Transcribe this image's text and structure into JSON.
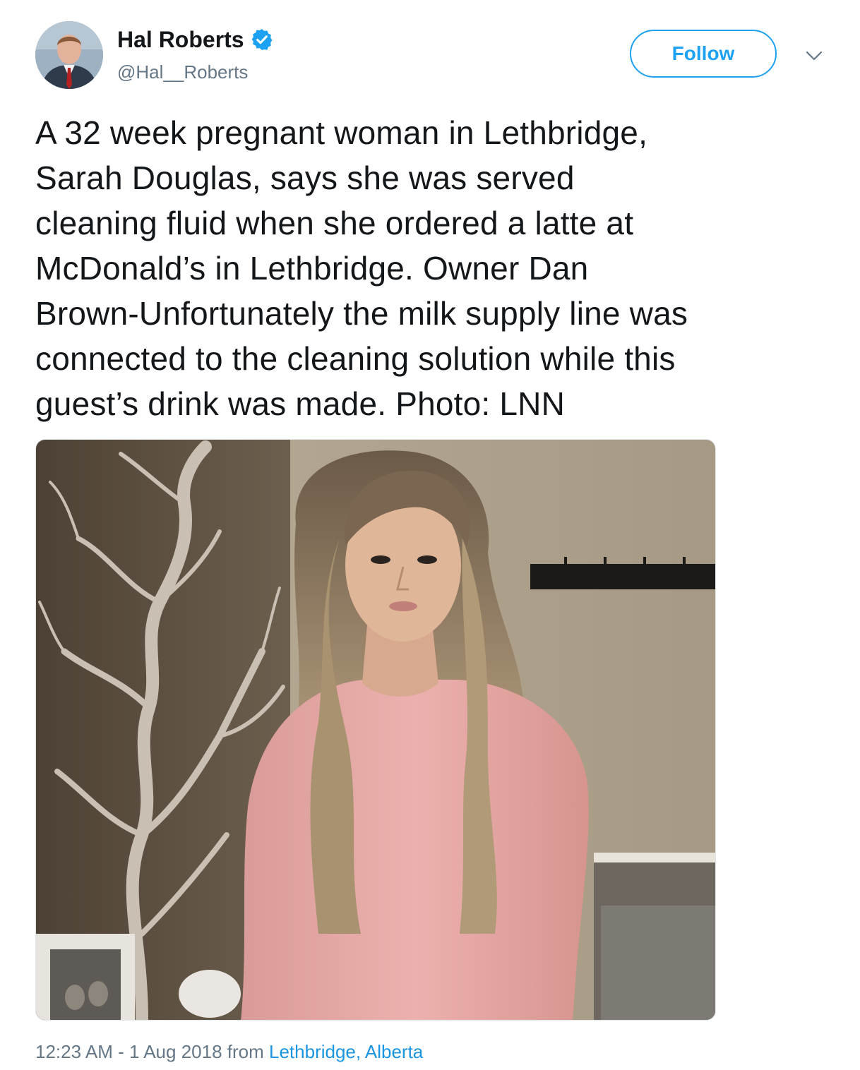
{
  "author": {
    "display_name": "Hal Roberts",
    "handle": "@Hal__Roberts",
    "verified": true,
    "verified_icon": "verified-badge-icon"
  },
  "actions": {
    "follow_label": "Follow",
    "more_icon": "chevron-down-icon"
  },
  "tweet": {
    "text_lines": [
      "A 32 week pregnant woman in Lethbridge,",
      "Sarah Douglas, says she was served",
      "cleaning fluid when she ordered a latte at",
      "McDonald’s in Lethbridge. Owner Dan",
      "Brown-Unfortunately the milk supply line was",
      "connected to the cleaning solution while this",
      "guest’s drink was made. Photo: LNN"
    ]
  },
  "meta": {
    "time": "12:23 AM",
    "separator": " - ",
    "date": "1 Aug 2018",
    "from_label": " from ",
    "location": "Lethbridge, Alberta"
  },
  "colors": {
    "accent": "#1da1f2",
    "link": "#1b95e0",
    "secondary_text": "#657786",
    "text": "#14171a",
    "wall": "#a89a85",
    "shirt": "#e8a7a5"
  }
}
